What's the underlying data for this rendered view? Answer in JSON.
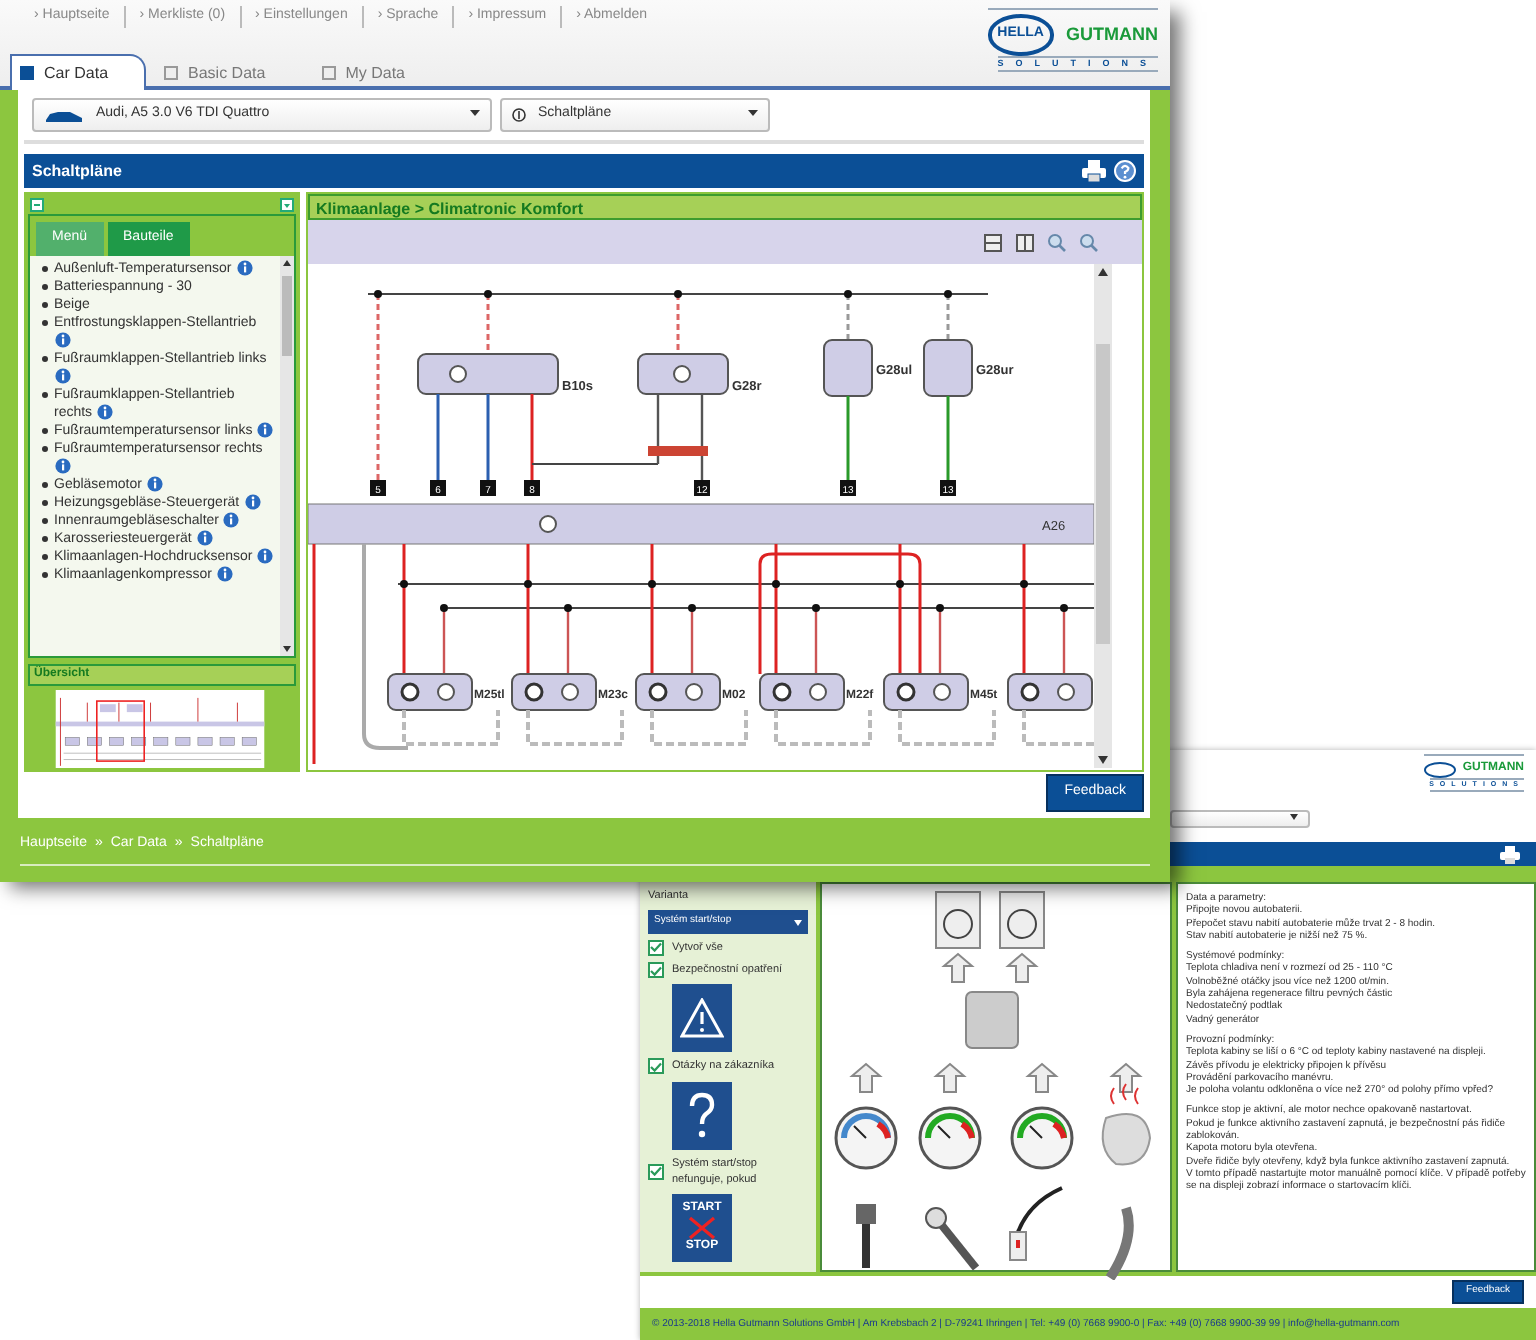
{
  "front": {
    "nav": [
      "› Hauptseite",
      "› Merkliste (0)",
      "› Einstellungen",
      "› Sprache",
      "› Impressum",
      "› Abmelden"
    ],
    "logo": {
      "brand": "HELLA",
      "name": "GUTMANN",
      "tagline": "SOLUTIONS"
    },
    "tabs": [
      {
        "label": "Car Data",
        "selected": true
      },
      {
        "label": "Basic Data",
        "selected": false
      },
      {
        "label": "My Data",
        "selected": false
      }
    ],
    "vehicle_select": {
      "value": "Audi, A5 3.0 V6 TDI Quattro"
    },
    "function_select": {
      "value": "Schaltpläne"
    },
    "panel_title": "Schaltpläne",
    "subtabs": [
      {
        "label": "Menü",
        "selected": true
      },
      {
        "label": "Bauteile",
        "selected": false
      }
    ],
    "components": [
      {
        "label": "Außenluft-Temperatursensor",
        "info": true
      },
      {
        "label": "Batteriespannung - 30",
        "info": false
      },
      {
        "label": "Beige",
        "info": false
      },
      {
        "label": "Entfrostungsklappen-Stellantrieb",
        "info": true
      },
      {
        "label": "Fußraumklappen-Stellantrieb links",
        "info": true
      },
      {
        "label": "Fußraumklappen-Stellantrieb rechts",
        "info": true
      },
      {
        "label": "Fußraumtemperatursensor links",
        "info": true
      },
      {
        "label": "Fußraumtemperatursensor rechts",
        "info": true
      },
      {
        "label": "Gebläsemotor",
        "info": true
      },
      {
        "label": "Heizungsgebläse-Steuergerät",
        "info": true
      },
      {
        "label": "Innenraumgebläseschalter",
        "info": true
      },
      {
        "label": "Karosseriesteuergerät",
        "info": true
      },
      {
        "label": "Klimaanlagen-Hochdrucksensor",
        "info": true
      },
      {
        "label": "Klimaanlagenkompressor",
        "info": true
      }
    ],
    "overview_title": "Übersicht",
    "diagram": {
      "title": "Klimaanlage > Climatronic Komfort",
      "upper_parts": [
        "B10s",
        "G28r",
        "G28ul",
        "G28ur"
      ],
      "bus_label": "A26",
      "terminals": [
        "5",
        "6",
        "7",
        "8",
        "12",
        "13",
        "13"
      ],
      "lower_parts": [
        "M25tl",
        "M23c",
        "M02",
        "M22f",
        "M45t"
      ]
    },
    "feedback": "Feedback",
    "breadcrumb": [
      "Hauptseite",
      "Car Data",
      "Schaltpläne"
    ],
    "breadcrumb_separator": "»"
  },
  "back": {
    "logo": {
      "name": "GUTMANN",
      "tagline": "SOLUTIONS"
    },
    "variant_label": "Varianta",
    "variant_select": {
      "value": "Systém start/stop"
    },
    "checks": [
      {
        "label": "Vytvoř vše",
        "checked": true,
        "kind": "plain"
      },
      {
        "label": "Bezpečnostní opatření",
        "checked": true,
        "kind": "warning"
      },
      {
        "label": "Otázky na zákazníka",
        "checked": true,
        "kind": "question"
      },
      {
        "label": "Systém start/stop nefunguje, pokud",
        "checked": true,
        "kind": "start-stop",
        "tile_texts": [
          "START",
          "STOP"
        ]
      }
    ],
    "info_text": [
      [
        "Data a parametry:",
        "Připojte novou autobaterii.",
        "Přepočet stavu nabití autobaterie může trvat 2 - 8 hodin.",
        "Stav nabití autobaterie je nižší než 75 %."
      ],
      [
        "Systémové podmínky:",
        "Teplota chladiva není v rozmezí od 25 - 110 °C",
        "Volnoběžné otáčky jsou více než 1200 ot/min.",
        "Byla zahájena regenerace filtru pevných částic",
        "Nedostatečný podtlak",
        "Vadný generátor"
      ],
      [
        "Provozní podmínky:",
        "Teplota kabiny se liší o 6 °C od teploty kabiny nastavené na displeji.",
        "Závěs přívodu je elektricky připojen k přívěsu",
        "Provádění parkovacího manévru.",
        "Je poloha volantu odkloněna o více než 270° od polohy přímo vpřed?"
      ],
      [
        "Funkce stop je aktivní, ale motor nechce opakovaně nastartovat.",
        "Pokud je funkce aktivního zastavení zapnutá, je bezpečnostní pás řidiče zablokován.",
        "Kapota motoru byla otevřena.",
        "Dveře řidiče byly otevřeny, když byla funkce aktivního zastavení zapnutá.",
        "V tomto případě nastartujte motor manuálně pomocí klíče. V případě potřeby se na displeji zobrazí informace o startovacím klíči."
      ]
    ],
    "feedback": "Feedback",
    "footer": "© 2013-2018 Hella Gutmann Solutions GmbH | Am Krebsbach 2 | D-79241 Ihringen | Tel: +49 (0) 7668 9900-0 | Fax: +49 (0) 7668 9900-39 99 | info@hella-gutmann.com"
  }
}
